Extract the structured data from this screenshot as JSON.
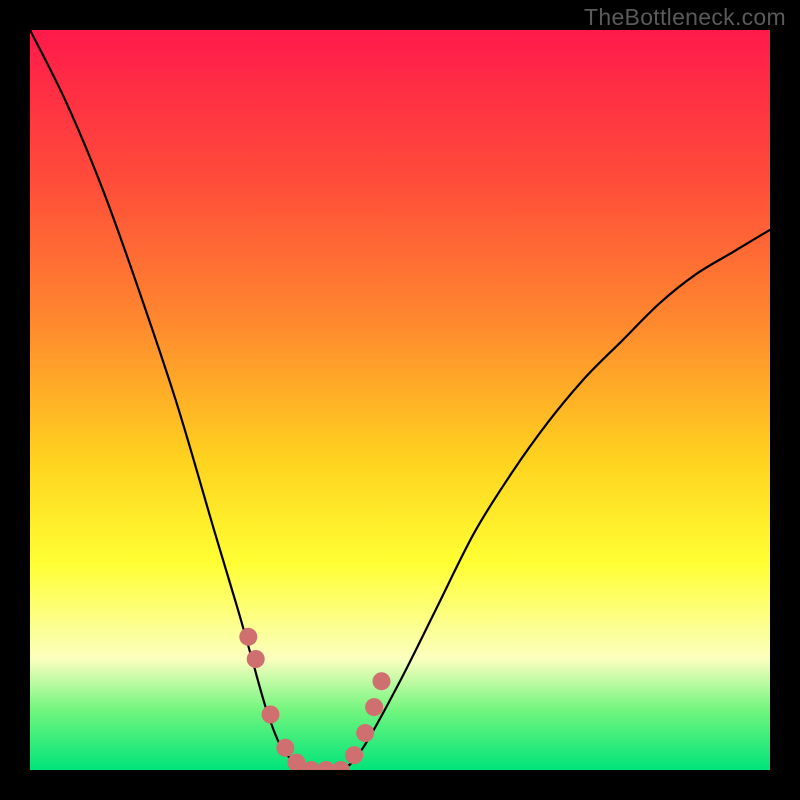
{
  "watermark": "TheBottleneck.com",
  "chart_data": {
    "type": "line",
    "title": "",
    "xlabel": "",
    "ylabel": "",
    "xlim": [
      0,
      100
    ],
    "ylim": [
      0,
      100
    ],
    "grid": false,
    "legend": false,
    "background_gradient_stops": [
      {
        "offset": 0.0,
        "color": "#ff1a4b"
      },
      {
        "offset": 0.2,
        "color": "#ff4b3a"
      },
      {
        "offset": 0.4,
        "color": "#ff8a2e"
      },
      {
        "offset": 0.58,
        "color": "#ffd21f"
      },
      {
        "offset": 0.72,
        "color": "#ffff33"
      },
      {
        "offset": 0.85,
        "color": "#fbffbf"
      },
      {
        "offset": 0.92,
        "color": "#70f57e"
      },
      {
        "offset": 1.0,
        "color": "#00e47a"
      }
    ],
    "series": [
      {
        "name": "bottleneck-curve",
        "type": "line",
        "color": "#000000",
        "x": [
          0,
          5,
          10,
          15,
          20,
          25,
          28,
          30,
          32,
          34,
          36,
          38,
          42,
          45,
          50,
          55,
          60,
          65,
          70,
          75,
          80,
          85,
          90,
          95,
          100
        ],
        "y": [
          100,
          90,
          78,
          64,
          49,
          32,
          22,
          15,
          8,
          3,
          1,
          0,
          0,
          3,
          12,
          22,
          32,
          40,
          47,
          53,
          58,
          63,
          67,
          70,
          73
        ]
      },
      {
        "name": "dot-markers",
        "type": "scatter",
        "color": "#cf6f70",
        "x": [
          29.5,
          30.5,
          32.5,
          34.5,
          36.0,
          38.0,
          40.0,
          42.0,
          43.8,
          45.3,
          46.5,
          47.5
        ],
        "y": [
          18.0,
          15.0,
          7.5,
          3.0,
          1.0,
          0.0,
          0.0,
          0.0,
          2.0,
          5.0,
          8.5,
          12.0
        ]
      }
    ],
    "annotations": []
  }
}
